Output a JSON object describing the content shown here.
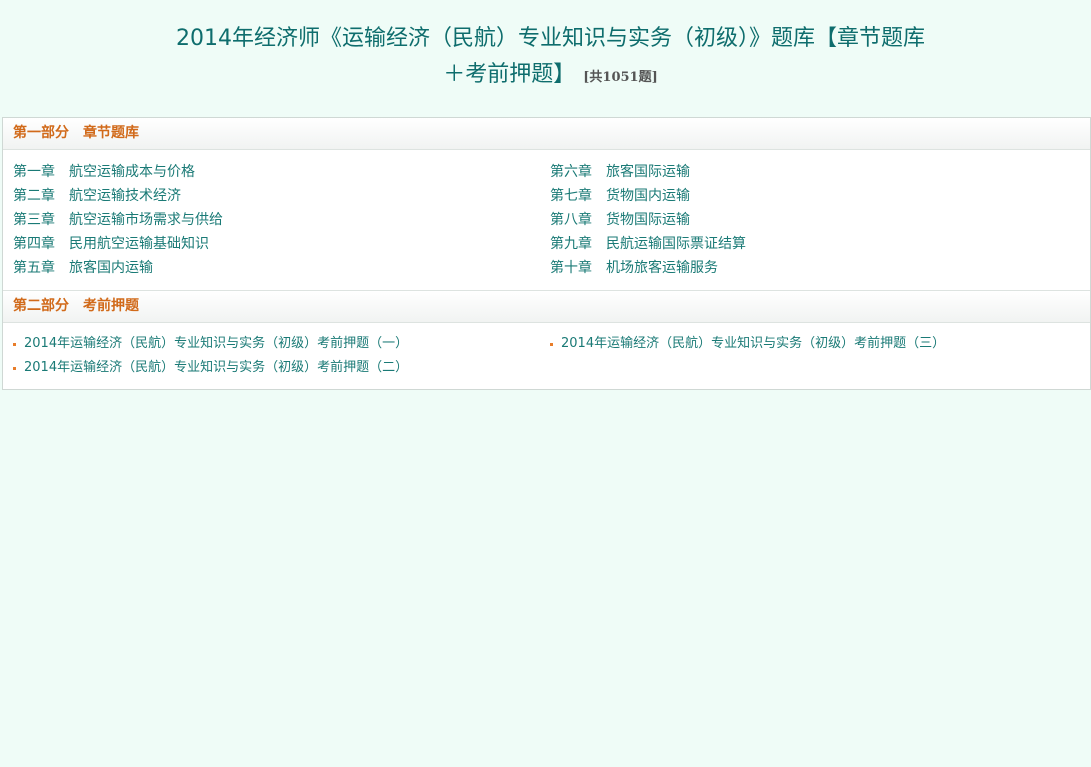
{
  "header": {
    "title_line1": "2014年经济师《运输经济（民航）专业知识与实务（初级）》题库【章节题库",
    "title_line2": "＋考前押题】",
    "count": "[共1051题]"
  },
  "sections": [
    {
      "part": "第一部分",
      "name": "章节题库",
      "chapters": [
        {
          "num": "第一章",
          "title": "航空运输成本与价格"
        },
        {
          "num": "第二章",
          "title": "航空运输技术经济"
        },
        {
          "num": "第三章",
          "title": "航空运输市场需求与供给"
        },
        {
          "num": "第四章",
          "title": "民用航空运输基础知识"
        },
        {
          "num": "第五章",
          "title": "旅客国内运输"
        },
        {
          "num": "第六章",
          "title": "旅客国际运输"
        },
        {
          "num": "第七章",
          "title": "货物国内运输"
        },
        {
          "num": "第八章",
          "title": "货物国际运输"
        },
        {
          "num": "第九章",
          "title": "民航运输国际票证结算"
        },
        {
          "num": "第十章",
          "title": "机场旅客运输服务"
        }
      ]
    },
    {
      "part": "第二部分",
      "name": "考前押题",
      "items": [
        "2014年运输经济（民航）专业知识与实务（初级）考前押题（一）",
        "2014年运输经济（民航）专业知识与实务（初级）考前押题（二）",
        "2014年运输经济（民航）专业知识与实务（初级）考前押题（三）"
      ]
    }
  ],
  "colors": {
    "background": "#effcf7",
    "title": "#0e6d6d",
    "section_title": "#d16a1a",
    "link": "#1a7a76",
    "bullet": "#e87d2a"
  }
}
